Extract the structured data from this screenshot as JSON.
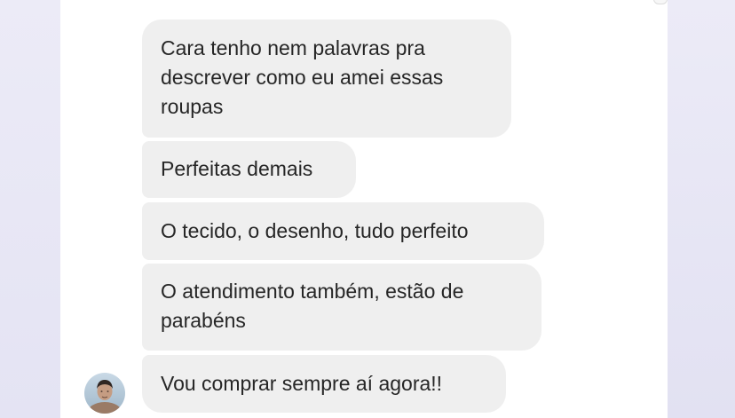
{
  "conversation": {
    "messages": [
      {
        "text": "Cara tenho nem palavras pra\ndescrever como eu amei essas\nroupas"
      },
      {
        "text": "Perfeitas demais"
      },
      {
        "text": "O tecido, o desenho, tudo perfeito"
      },
      {
        "text": "O atendimento também, estão de\nparabéns"
      },
      {
        "text": "Vou comprar sempre aí agora!!"
      }
    ],
    "sender_avatar": "user-avatar-photo"
  },
  "colors": {
    "bubble_background": "#efefef",
    "text": "#262626",
    "page_background": "#e8e7f4",
    "panel_background": "#ffffff",
    "scrollbar": "#a9a9ad"
  }
}
